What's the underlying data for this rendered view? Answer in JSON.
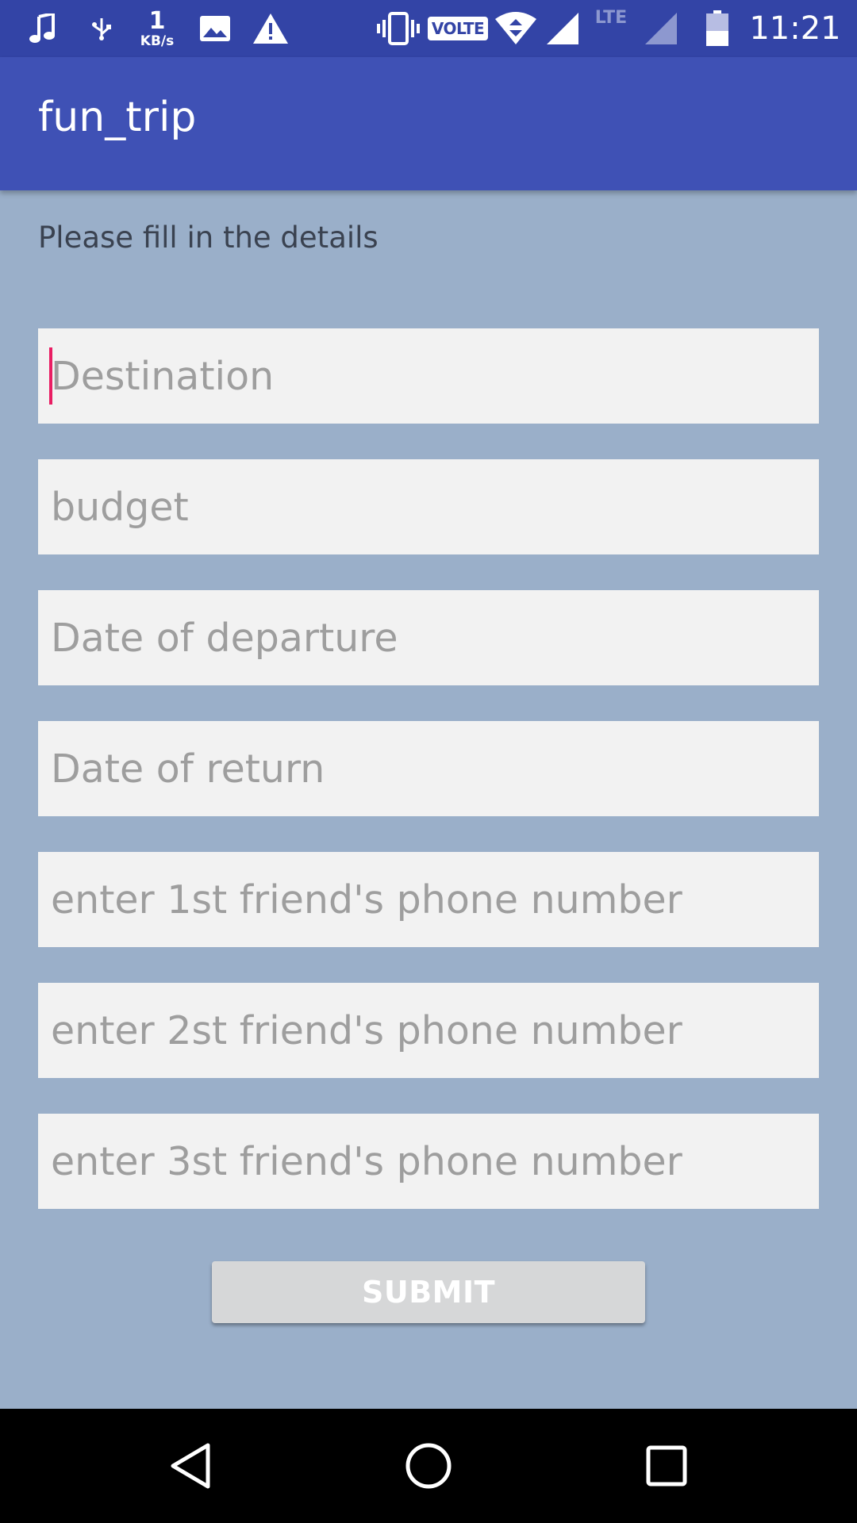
{
  "status_bar": {
    "speed_value": "1",
    "speed_unit": "KB/s",
    "volte": "VOLTE",
    "lte": "LTE",
    "time": "11:21",
    "icons": [
      "music-icon",
      "usb-icon",
      "image-icon",
      "warning-icon",
      "vibrate-icon",
      "wifi-icon",
      "signal-icon",
      "signal-2-icon",
      "battery-icon"
    ]
  },
  "app_bar": {
    "title": "fun_trip"
  },
  "form": {
    "instructions": "Please fill in the details",
    "fields": [
      {
        "placeholder": "Destination",
        "value": "",
        "focused": true
      },
      {
        "placeholder": "budget",
        "value": ""
      },
      {
        "placeholder": "Date of departure",
        "value": ""
      },
      {
        "placeholder": "Date of return",
        "value": ""
      },
      {
        "placeholder": "enter 1st friend's phone number",
        "value": ""
      },
      {
        "placeholder": "enter 2st friend's phone number",
        "value": ""
      },
      {
        "placeholder": "enter 3st friend's phone number",
        "value": ""
      }
    ],
    "submit_label": "SUBMIT"
  },
  "nav_bar": {
    "icons": [
      "back-icon",
      "home-icon",
      "recents-icon"
    ]
  },
  "colors": {
    "status_bar": "#3344a6",
    "app_bar": "#3f51b5",
    "background": "#9aafc9",
    "field": "#f2f2f2",
    "cursor": "#e91e63",
    "button": "#d6d7d8"
  }
}
